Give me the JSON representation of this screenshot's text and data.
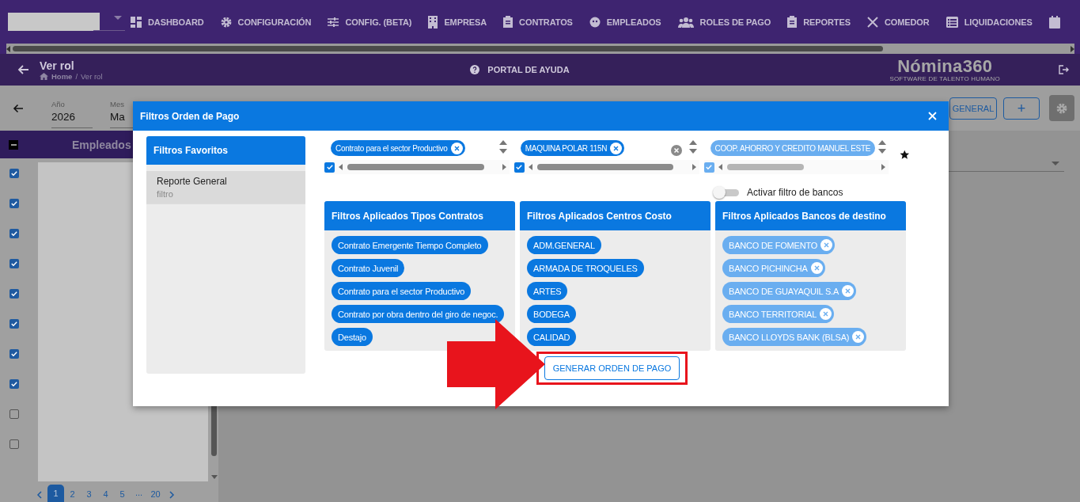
{
  "nav": {
    "items": [
      {
        "label": "DASHBOARD"
      },
      {
        "label": "CONFIGURACIÓN"
      },
      {
        "label": "CONFIG. (BETA)"
      },
      {
        "label": "EMPRESA"
      },
      {
        "label": "CONTRATOS"
      },
      {
        "label": "EMPLEADOS"
      },
      {
        "label": "ROLES DE PAGO"
      },
      {
        "label": "REPORTES"
      },
      {
        "label": "COMEDOR"
      },
      {
        "label": "LIQUIDACIONES"
      }
    ]
  },
  "header": {
    "title": "Ver rol",
    "breadcrumb": [
      "Home",
      "Ver rol"
    ],
    "breadcrumb_separator": "/",
    "help": "PORTAL DE AYUDA",
    "logo": "Nómina360",
    "tagline": "SOFTWARE DE TALENTO HUMANO"
  },
  "toolbar": {
    "fields": [
      {
        "label": "Año",
        "value": "2026"
      },
      {
        "label": "Mes",
        "value": "Ma"
      }
    ],
    "general_button": "GENERAL",
    "add_button": "+"
  },
  "employees": {
    "title": "Empleados",
    "select_all_indeterminate": true,
    "rows": [
      {
        "checked": true
      },
      {
        "checked": true
      },
      {
        "checked": true
      },
      {
        "checked": true
      },
      {
        "checked": true
      },
      {
        "checked": true
      },
      {
        "checked": true
      },
      {
        "checked": true
      },
      {
        "checked": false
      },
      {
        "checked": false
      }
    ],
    "pages": [
      {
        "label": "1",
        "selected": true
      },
      {
        "label": "2",
        "selected": false
      },
      {
        "label": "3",
        "selected": false
      },
      {
        "label": "4",
        "selected": false
      },
      {
        "label": "5",
        "selected": false
      }
    ],
    "ellipsis": "...",
    "last_page": {
      "label": "20",
      "selected": false
    }
  },
  "modal": {
    "title": "Filtros Orden de Pago",
    "favorites": {
      "title": "Filtros Favoritos",
      "items": [
        {
          "name": "Reporte General",
          "description": "filtro",
          "selected": true
        }
      ]
    },
    "selects": [
      {
        "checked": true,
        "clearable": false,
        "chips": [
          {
            "label": "Contrato para el sector Productivo",
            "removable": true
          }
        ]
      },
      {
        "checked": true,
        "clearable": true,
        "chips": [
          {
            "label": "MAQUINA POLAR 115N",
            "removable": true
          }
        ]
      },
      {
        "checked": true,
        "clearable": false,
        "chips": [
          {
            "label": "COOP. AHORRO Y CREDITO MANUEL ESTE",
            "removable": false
          }
        ]
      }
    ],
    "bank_filter": {
      "label": "Activar filtro de bancos",
      "on": false
    },
    "cards": [
      {
        "title": "Filtros Aplicados Tipos Contratos",
        "chips": [
          {
            "label": "Contrato Emergente Tiempo Completo",
            "removable": false
          },
          {
            "label": "Contrato Juvenil",
            "removable": false
          },
          {
            "label": "Contrato para el sector Productivo",
            "removable": false
          },
          {
            "label": "Contrato por obra dentro del giro de negoc.",
            "removable": false
          },
          {
            "label": "Destajo",
            "removable": false
          }
        ]
      },
      {
        "title": "Filtros Aplicados Centros Costo",
        "chips": [
          {
            "label": "ADM.GENERAL",
            "removable": false
          },
          {
            "label": "ARMADA DE TROQUELES",
            "removable": false
          },
          {
            "label": "ARTES",
            "removable": false
          },
          {
            "label": "BODEGA",
            "removable": false
          },
          {
            "label": "CALIDAD",
            "removable": false
          }
        ]
      },
      {
        "title": "Filtros Aplicados Bancos de destino",
        "chips": [
          {
            "label": "BANCO DE FOMENTO",
            "removable": true
          },
          {
            "label": "BANCO PICHINCHA",
            "removable": true
          },
          {
            "label": "BANCO DE GUAYAQUIL S.A",
            "removable": true
          },
          {
            "label": "BANCO TERRITORIAL",
            "removable": true
          },
          {
            "label": "BANCO LLOYDS BANK (BLSA)",
            "removable": true
          }
        ]
      }
    ],
    "submit": {
      "label": "GENERAR ORDEN DE PAGO",
      "highlighted": true
    }
  }
}
